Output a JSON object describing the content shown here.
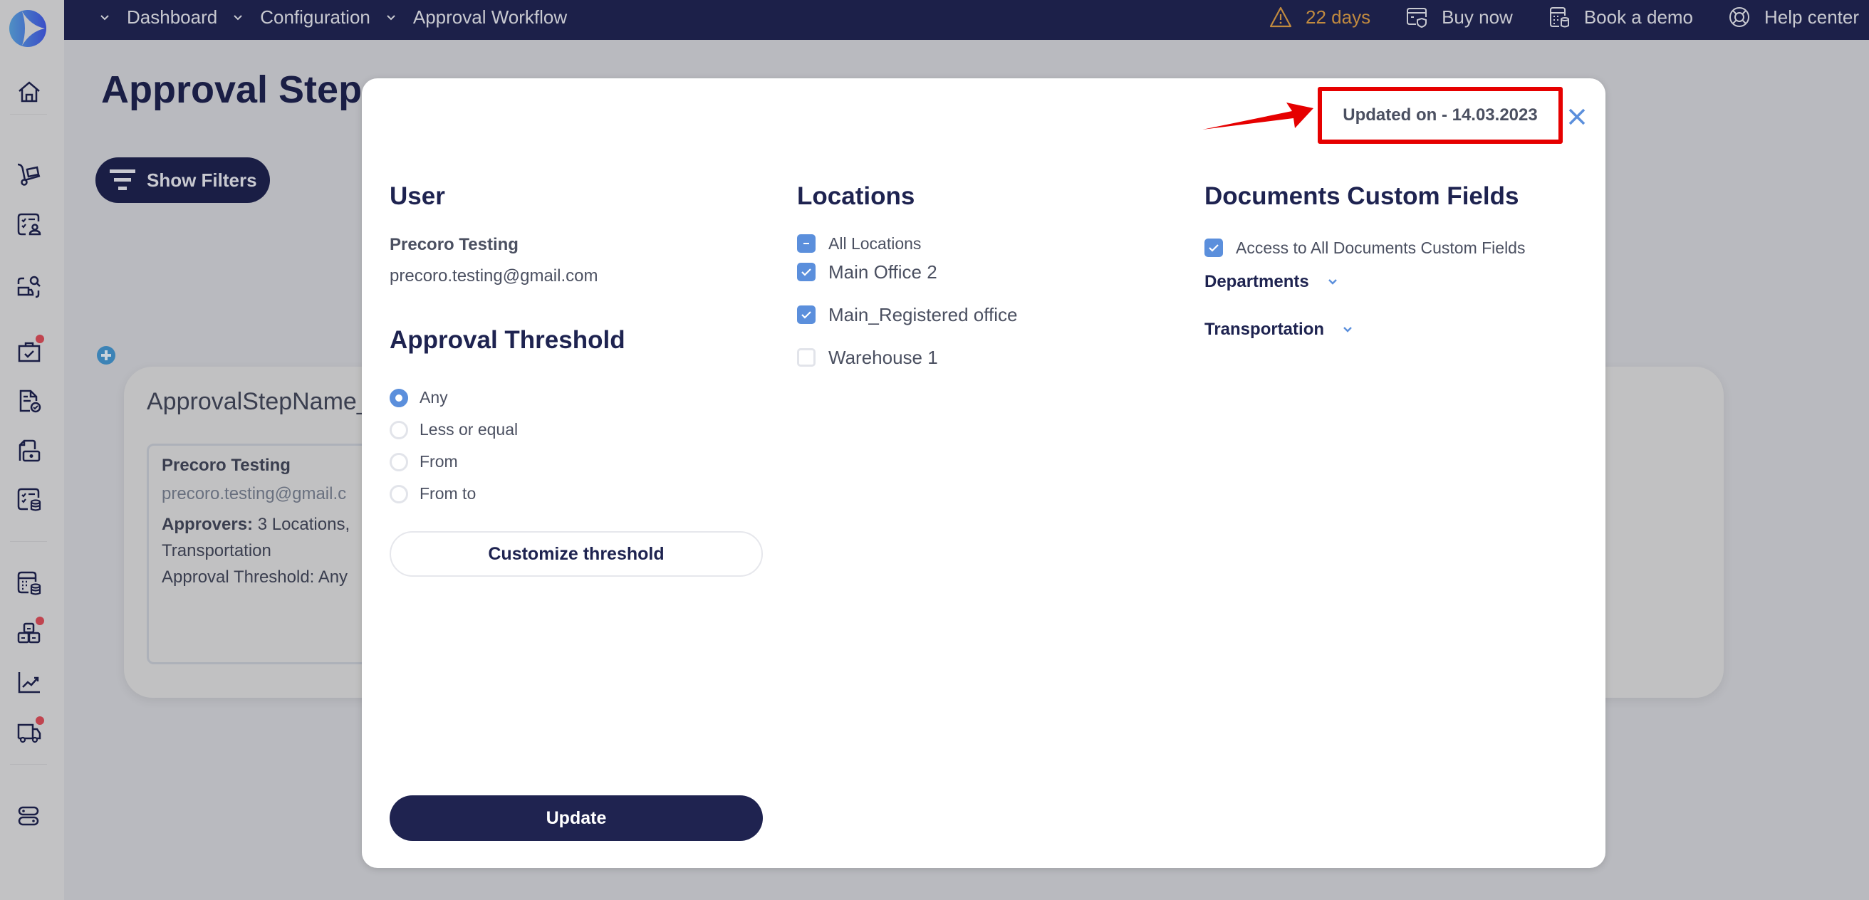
{
  "topbar": {
    "breadcrumbs": [
      {
        "label": "Dashboard",
        "icon": "chevron-down-icon"
      },
      {
        "label": "Configuration",
        "icon": "chevron-down-icon"
      },
      {
        "label": "Approval Workflow",
        "icon": "chevron-down-icon"
      }
    ],
    "trial": {
      "label": "22 days",
      "icon": "warning-icon",
      "color": "#c18a3f"
    },
    "buy_now": {
      "label": "Buy now",
      "icon": "card-shield-icon"
    },
    "book_demo": {
      "label": "Book a demo",
      "icon": "calculator-icon"
    },
    "help_center": {
      "label": "Help center",
      "icon": "lifebuoy-icon"
    }
  },
  "sidebar": {
    "items": [
      {
        "name": "home",
        "icon": "home-icon",
        "badge": false
      },
      {
        "name": "receiving",
        "icon": "hand-truck-icon",
        "badge": false
      },
      {
        "name": "requisitions",
        "icon": "checklist-user-icon",
        "badge": false
      },
      {
        "name": "suppliers",
        "icon": "truck-search-icon",
        "badge": false
      },
      {
        "name": "approvals",
        "icon": "briefcase-check-icon",
        "badge": true
      },
      {
        "name": "invoices",
        "icon": "document-check-icon",
        "badge": false
      },
      {
        "name": "payments",
        "icon": "wallet-icon",
        "badge": false
      },
      {
        "name": "budgets",
        "icon": "checklist-database-icon",
        "badge": false
      },
      {
        "name": "budget-calc",
        "icon": "calculator-database-icon",
        "badge": false
      },
      {
        "name": "inventory",
        "icon": "boxes-icon",
        "badge": true
      },
      {
        "name": "analytics",
        "icon": "chart-line-icon",
        "badge": false
      },
      {
        "name": "deliveries",
        "icon": "truck-icon",
        "badge": true
      },
      {
        "name": "settings",
        "icon": "toggles-icon",
        "badge": false
      }
    ]
  },
  "page": {
    "title": "Approval Steps",
    "show_filters": "Show Filters",
    "step": {
      "name": "ApprovalStepName_",
      "approver_name": "Precoro Testing",
      "approver_email": "precoro.testing@gmail.c",
      "approvers_label": "Approvers:",
      "approvers_value": "3 Locations,",
      "approvers_line2": "Transportation",
      "threshold_line": "Approval Threshold: Any"
    }
  },
  "modal": {
    "updated_on": "Updated on - 14.03.2023",
    "annotation_color": "#e60000",
    "user": {
      "heading": "User",
      "name": "Precoro Testing",
      "email": "precoro.testing@gmail.com"
    },
    "threshold": {
      "heading": "Approval Threshold",
      "options": [
        {
          "label": "Any",
          "selected": true
        },
        {
          "label": "Less or equal",
          "selected": false
        },
        {
          "label": "From",
          "selected": false
        },
        {
          "label": "From to",
          "selected": false
        }
      ],
      "customize_label": "Customize threshold"
    },
    "locations": {
      "heading": "Locations",
      "all": {
        "label": "All Locations",
        "state": "indeterminate"
      },
      "items": [
        {
          "label": "Main Office 2",
          "checked": true
        },
        {
          "label": "Main_Registered office",
          "checked": true
        },
        {
          "label": "Warehouse 1",
          "checked": false
        }
      ]
    },
    "custom_fields": {
      "heading": "Documents Custom Fields",
      "access_all": {
        "label": "Access to All Documents Custom Fields",
        "checked": true
      },
      "groups": [
        {
          "label": "Departments",
          "expanded": false
        },
        {
          "label": "Transportation",
          "expanded": false
        }
      ]
    },
    "update_label": "Update",
    "accent_color": "#5b8fdc"
  }
}
